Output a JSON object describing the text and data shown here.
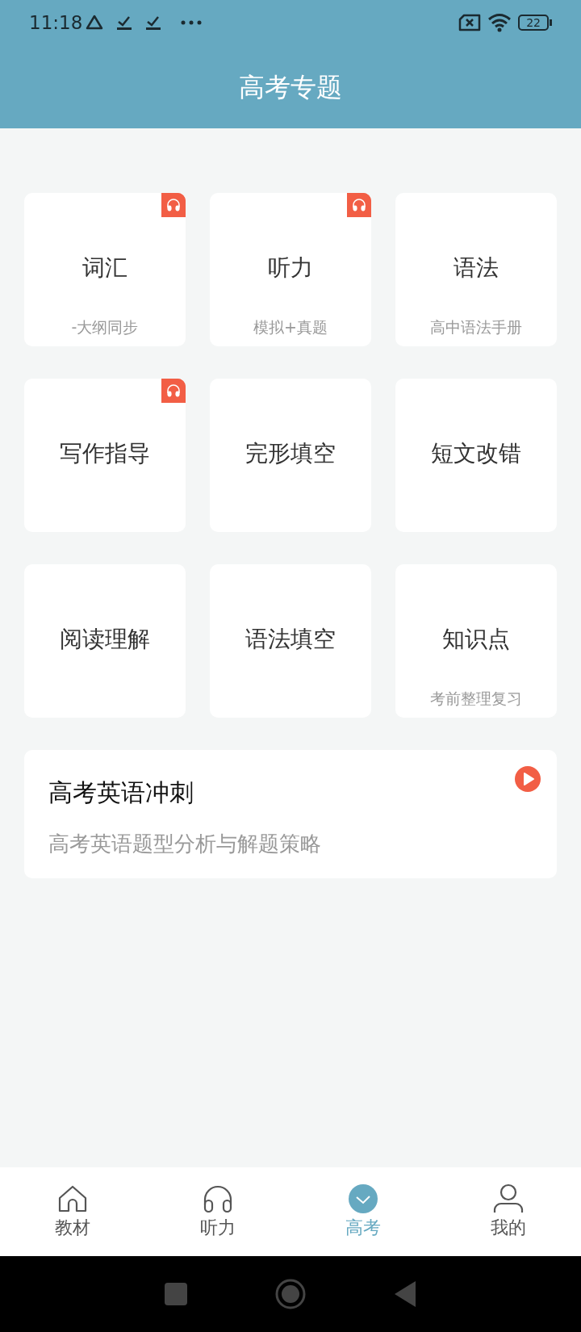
{
  "status_bar": {
    "time": "11:18",
    "battery": "22"
  },
  "header": {
    "title": "高考专题"
  },
  "tiles": [
    {
      "title": "词汇",
      "subtitle": "-大纲同步",
      "audio": true
    },
    {
      "title": "听力",
      "subtitle": "模拟+真题",
      "audio": true
    },
    {
      "title": "语法",
      "subtitle": "高中语法手册",
      "audio": false
    },
    {
      "title": "写作指导",
      "audio": true
    },
    {
      "title": "完形填空",
      "audio": false
    },
    {
      "title": "短文改错",
      "audio": false
    },
    {
      "title": "阅读理解",
      "audio": false
    },
    {
      "title": "语法填空",
      "audio": false
    },
    {
      "title": "知识点",
      "subtitle": "考前整理复习",
      "audio": false
    }
  ],
  "banner": {
    "title": "高考英语冲刺",
    "subtitle": "高考英语题型分析与解题策略"
  },
  "tab_bar": [
    {
      "label": "教材",
      "kind": "home",
      "selected": false
    },
    {
      "label": "听力",
      "kind": "headphones",
      "selected": false
    },
    {
      "label": "高考",
      "kind": "check",
      "selected": true
    },
    {
      "label": "我的",
      "kind": "person",
      "selected": false
    }
  ]
}
